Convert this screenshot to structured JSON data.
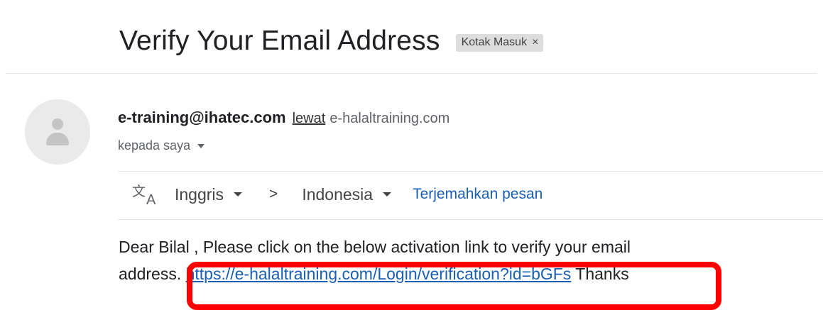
{
  "message": {
    "subject": "Verify Your Email Address",
    "label_chip": {
      "text": "Kotak Masuk",
      "remove_glyph": "×"
    },
    "sender": {
      "email": "e-training@ihatec.com",
      "via_label": "lewat",
      "via_domain": "e-halaltraining.com",
      "avatar_icon": "person-placeholder-icon"
    },
    "recipient_label": "kepada saya"
  },
  "translate_bar": {
    "icon": "translate-icon",
    "source_language": "Inggris",
    "separator": ">",
    "target_language": "Indonesia",
    "action_label": "Terjemahkan pesan"
  },
  "body": {
    "line1": "Dear Bilal , Please click on the below activation link to verify your email",
    "line2_prefix": "address. ",
    "link_text": "https://e-halaltraining.com/Login/verification?id=bGFs",
    "line2_suffix": " Thanks"
  },
  "colors": {
    "link": "#1a5fb4",
    "highlight": "#ff0000",
    "chip_background": "#dddddd"
  }
}
